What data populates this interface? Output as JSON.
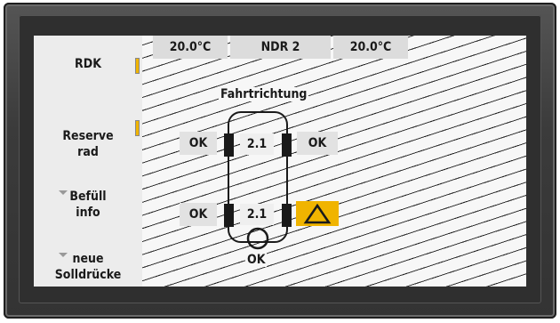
{
  "sidebar": {
    "items": [
      {
        "label": "RDK",
        "indicator": true
      },
      {
        "label": "Reserve\nrad",
        "indicator": true
      },
      {
        "label": "Befüll\ninfo",
        "arrow": true
      },
      {
        "label": "neue\nSolldrücke",
        "arrow": true
      }
    ]
  },
  "header": {
    "left_temp": "20.0°C",
    "station": "NDR 2",
    "right_temp": "20.0°C"
  },
  "diagram": {
    "direction_label": "Fahrtrichtung",
    "front_left_status": "OK",
    "front_left_pressure": "2.1",
    "front_right_status": "OK",
    "rear_left_status": "OK",
    "rear_left_pressure": "2.1",
    "rear_right_status": "warning",
    "spare_status": "OK"
  },
  "colors": {
    "warning": "#f0b400",
    "indicator": "#f0b400"
  }
}
